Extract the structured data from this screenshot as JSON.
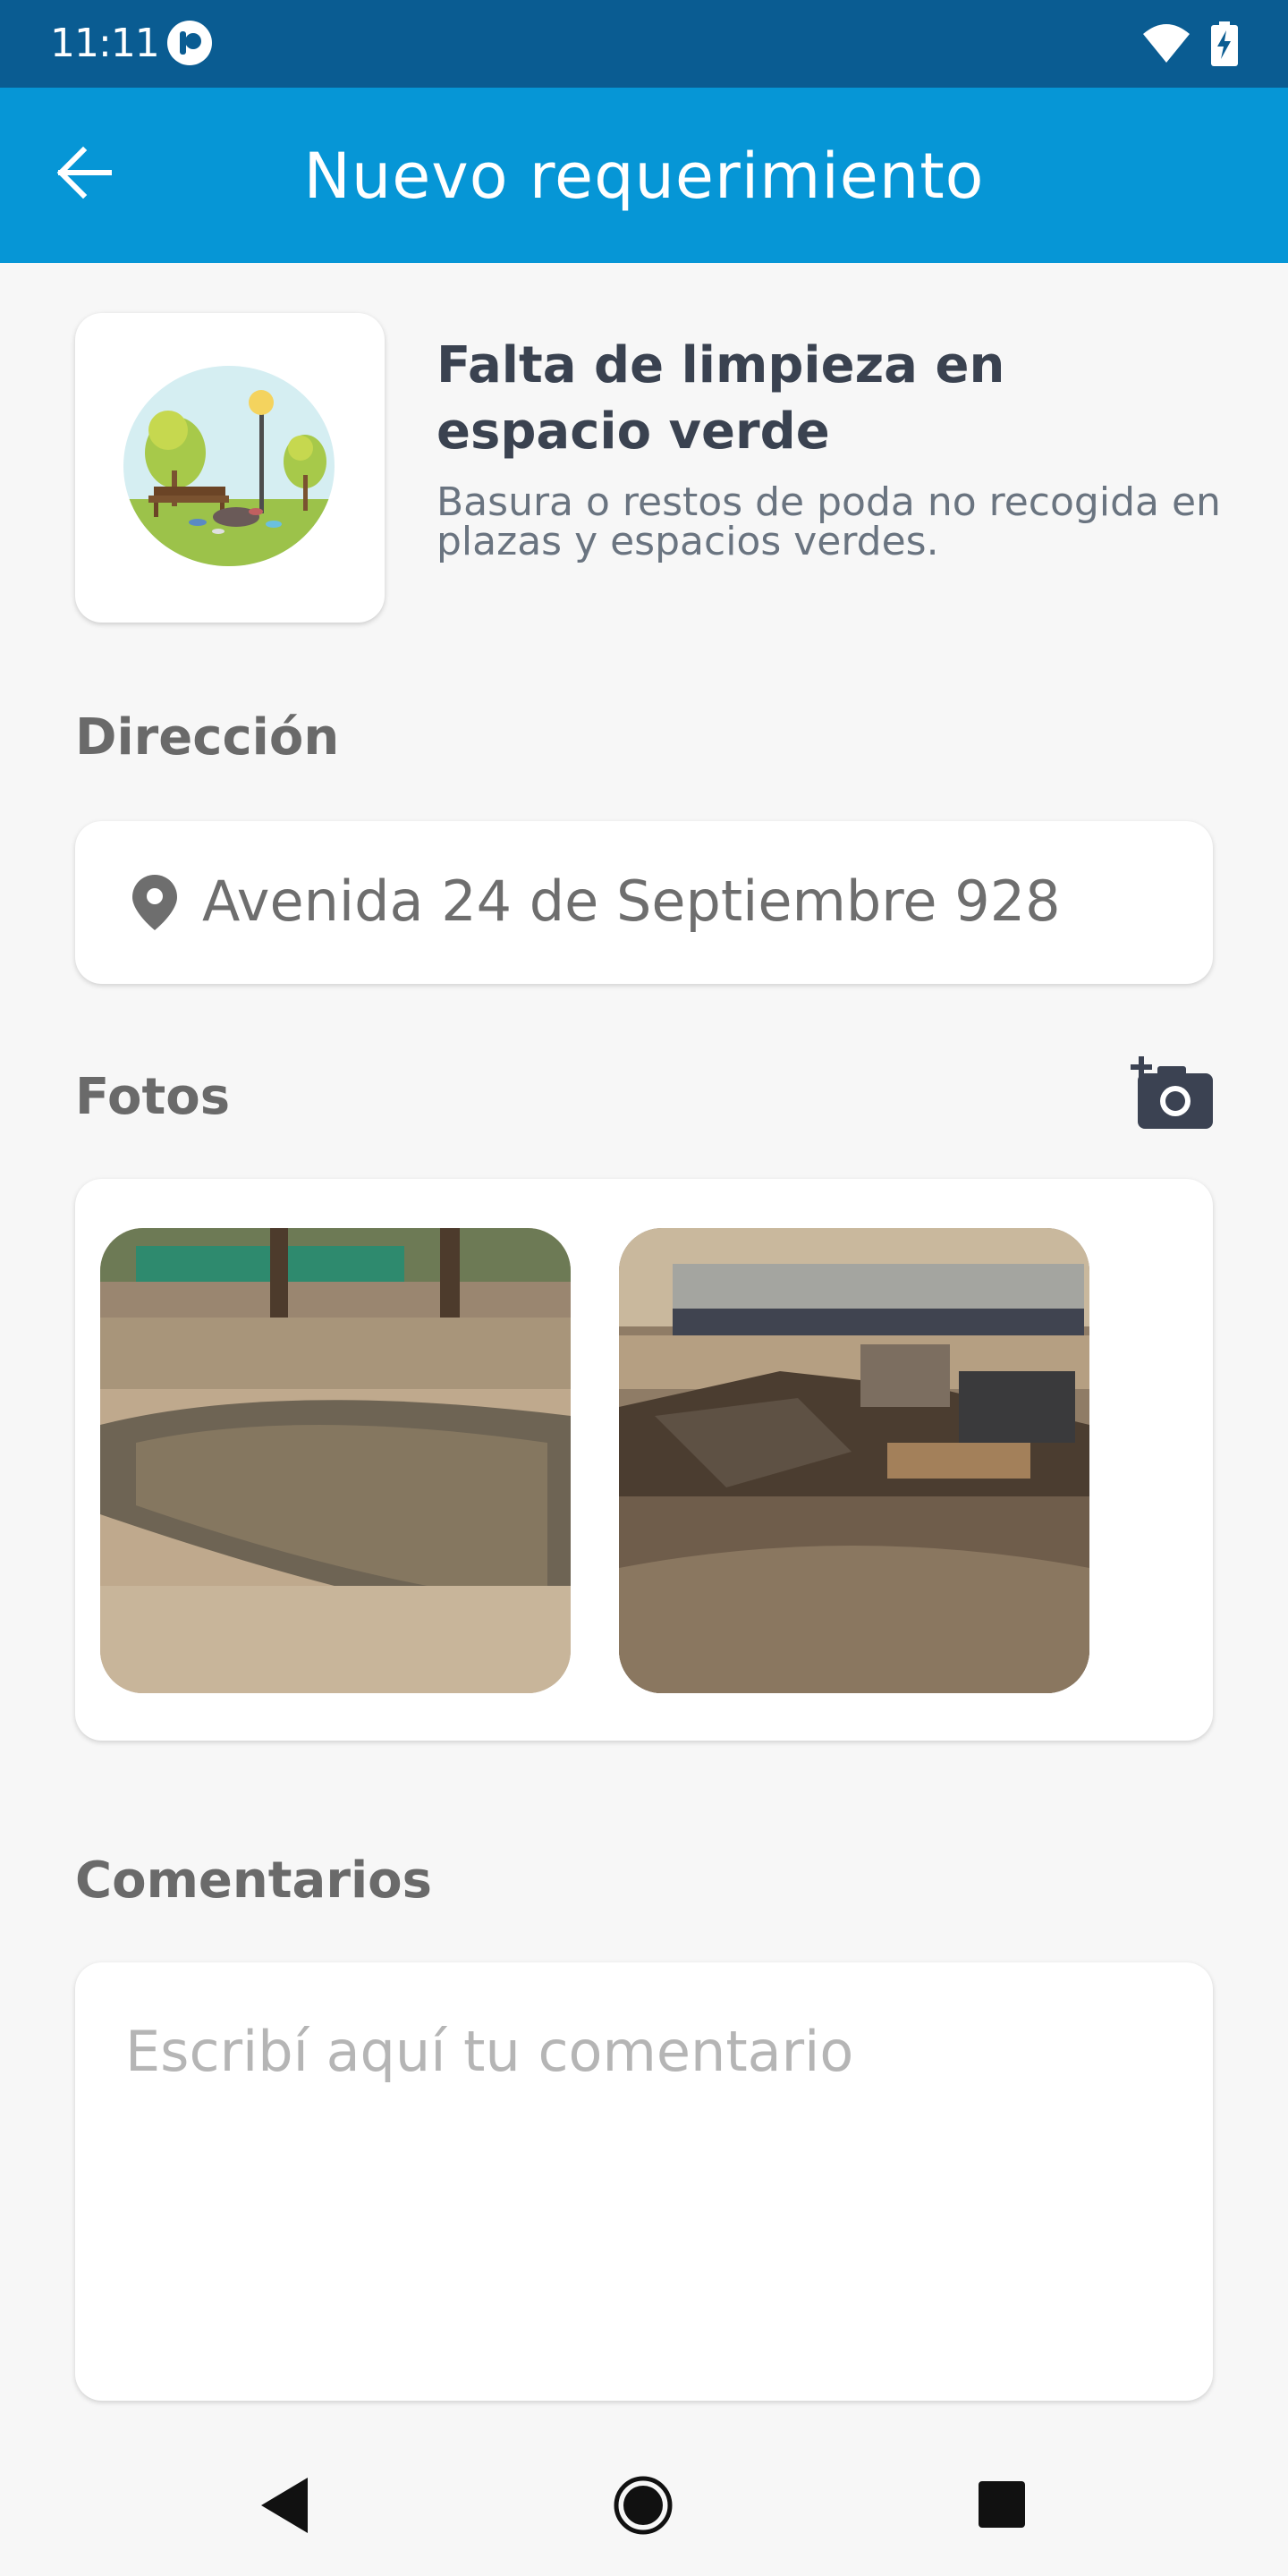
{
  "status_bar": {
    "time": "11:11",
    "icons": [
      "app-notification-icon",
      "wifi-icon",
      "battery-charging-icon"
    ]
  },
  "app_bar": {
    "title": "Nuevo requerimiento",
    "back_icon": "arrow-back-icon",
    "background_color": "#0696d6"
  },
  "category": {
    "title": "Falta de limpieza en espacio verde",
    "description": "Basura o restos de poda no recogida en plazas y espacios verdes.",
    "illustration": "park-with-trash-illustration"
  },
  "address": {
    "label": "Dirección",
    "value": "Avenida 24 de Septiembre 928",
    "icon": "location-pin-icon"
  },
  "photos": {
    "label": "Fotos",
    "add_icon": "add-photo-camera-icon",
    "items": [
      {
        "description_icon": "photo-puddle-in-park"
      },
      {
        "description_icon": "photo-debris-pile-in-park"
      }
    ]
  },
  "comments": {
    "label": "Comentarios",
    "placeholder": "Escribí aquí tu comentario",
    "value": ""
  },
  "nav_bar": {
    "icons": [
      "nav-back-icon",
      "nav-home-icon",
      "nav-recents-icon"
    ]
  }
}
